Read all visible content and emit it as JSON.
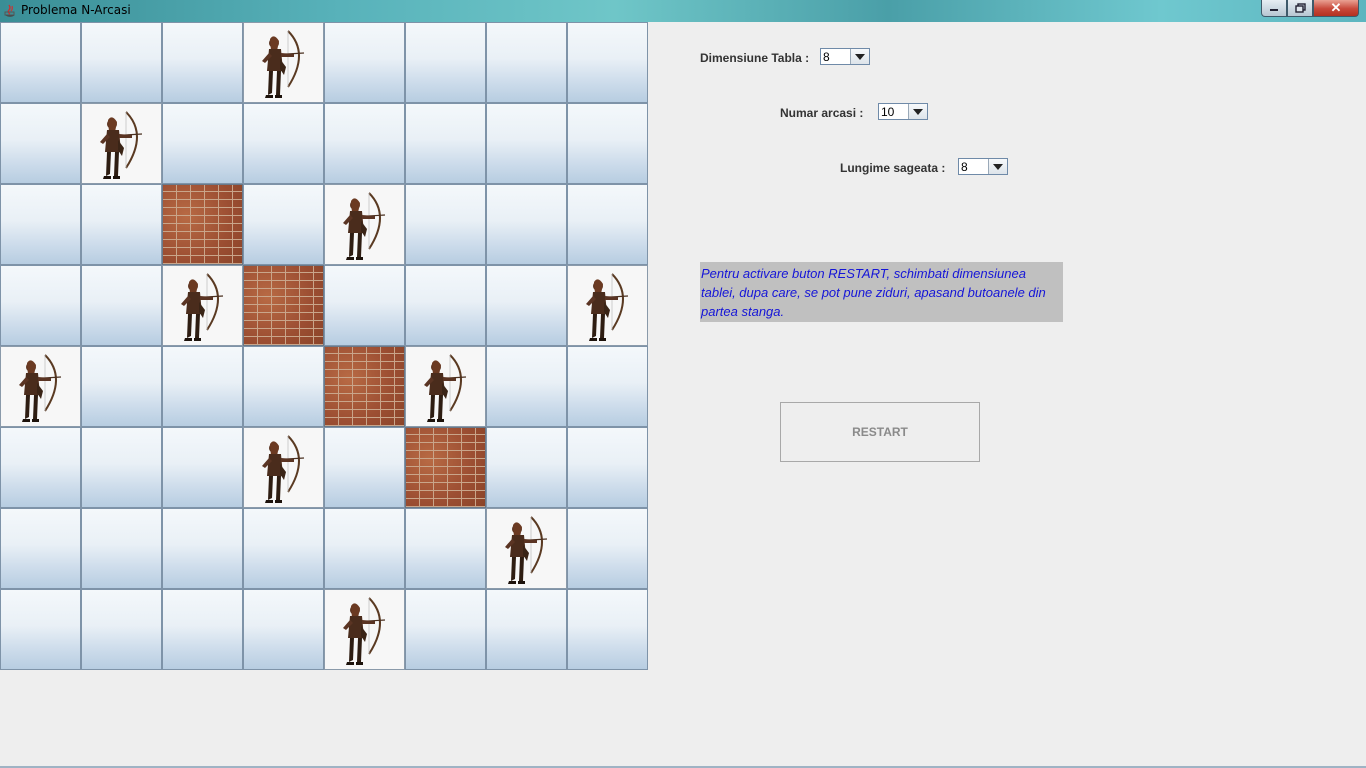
{
  "window": {
    "title": "Problema N-Arcasi",
    "controls": [
      "minimize",
      "maximize",
      "close"
    ]
  },
  "board": {
    "size": 8,
    "rows": [
      [
        "empty",
        "empty",
        "empty",
        "archer",
        "empty",
        "empty",
        "empty",
        "empty"
      ],
      [
        "empty",
        "archer",
        "empty",
        "empty",
        "empty",
        "empty",
        "empty",
        "empty"
      ],
      [
        "empty",
        "empty",
        "wall",
        "empty",
        "archer",
        "empty",
        "empty",
        "empty"
      ],
      [
        "empty",
        "empty",
        "archer",
        "wall",
        "empty",
        "empty",
        "empty",
        "archer"
      ],
      [
        "archer",
        "empty",
        "empty",
        "empty",
        "wall",
        "archer",
        "empty",
        "empty"
      ],
      [
        "empty",
        "empty",
        "empty",
        "archer",
        "empty",
        "wall",
        "empty",
        "empty"
      ],
      [
        "empty",
        "empty",
        "empty",
        "empty",
        "empty",
        "empty",
        "archer",
        "empty"
      ],
      [
        "empty",
        "empty",
        "empty",
        "empty",
        "archer",
        "empty",
        "empty",
        "empty"
      ]
    ]
  },
  "settings": {
    "board_size": {
      "label": "Dimensiune Tabla :",
      "value": "8"
    },
    "archers": {
      "label": "Numar arcasi :",
      "value": "10"
    },
    "arrow_length": {
      "label": "Lungime sageata :",
      "value": "8"
    }
  },
  "info_text": "Pentru activare buton RESTART, schimbati dimensiunea tablei, dupa care, se pot pune ziduri, apasand butoanele din partea stanga.",
  "restart_label": "RESTART"
}
